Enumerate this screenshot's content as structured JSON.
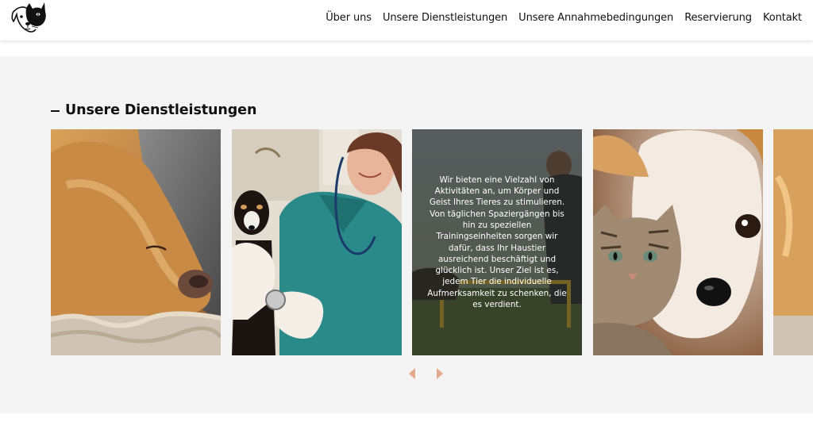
{
  "header": {
    "logo_icon": "cat-dog-logo-icon",
    "nav": [
      {
        "label": "Über uns"
      },
      {
        "label": "Unsere Dienstleistungen"
      },
      {
        "label": "Unsere Annahmebedingungen"
      },
      {
        "label": "Reservierung"
      },
      {
        "label": "Kontakt"
      }
    ]
  },
  "services": {
    "title": "Unsere Dienstleistungen",
    "cards": [
      {
        "image": "dog-and-cat-sleeping-photo"
      },
      {
        "image": "vet-with-puppy-photo"
      },
      {
        "image": "dog-training-photo",
        "text": "Wir bieten eine Vielzahl von Aktivitäten an, um Körper und Geist Ihres Tieres zu stimulieren. Von täglichen Spaziergängen bis hin zu speziellen Trainingseinheiten sorgen wir dafür, dass Ihr Haustier ausreichend beschäftigt und glücklich ist. Unser Ziel ist es, jedem Tier die individuelle Aufmerksamkeit zu schenken, die es verdient."
      },
      {
        "image": "kitten-and-puppy-photo"
      },
      {
        "image": "golden-dog-photo"
      }
    ],
    "prev_icon": "caret-left-icon",
    "next_icon": "caret-right-icon"
  },
  "colors": {
    "section_bg": "#f4f4f4",
    "arrow": "#e3a98a",
    "overlay": "#262a28"
  }
}
